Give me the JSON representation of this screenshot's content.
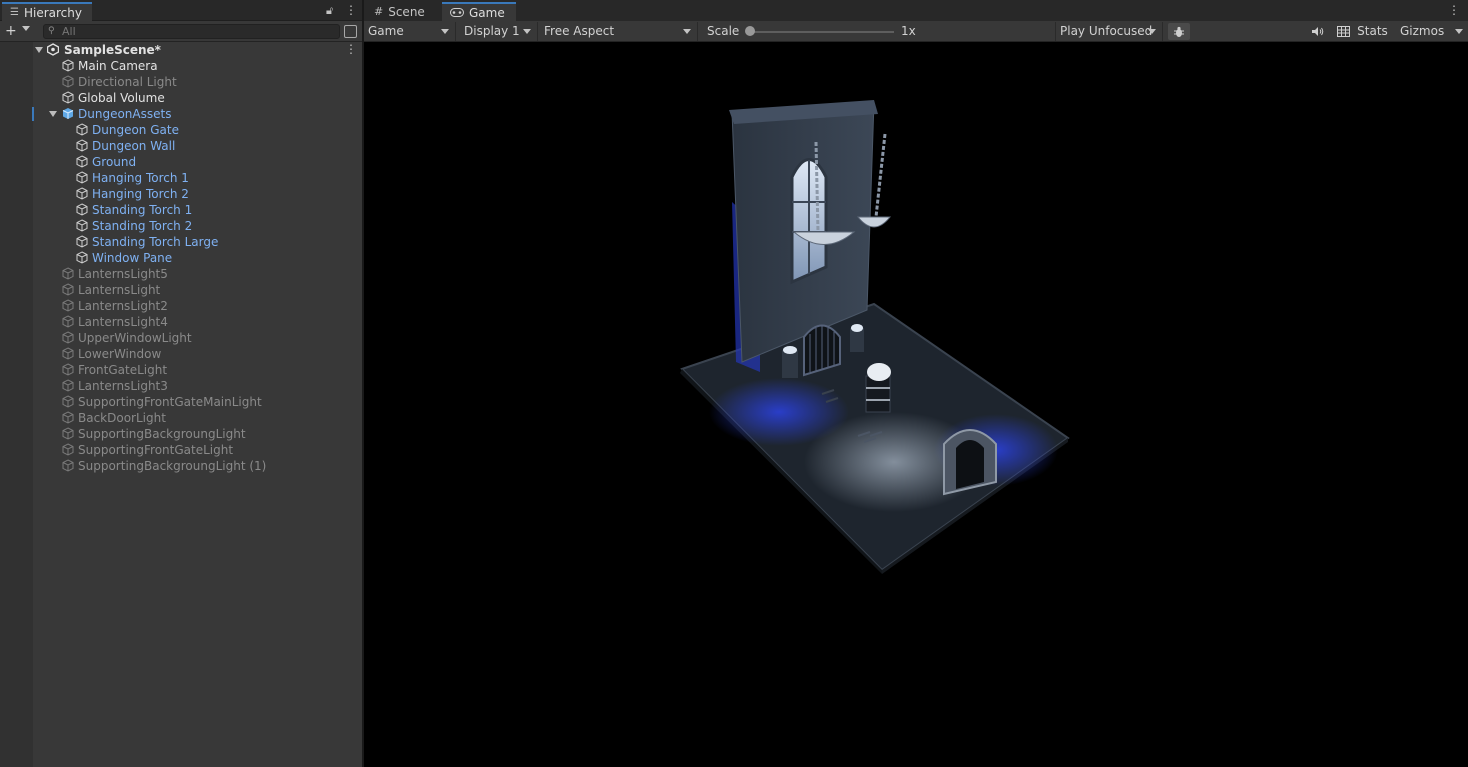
{
  "hierarchy": {
    "tab_label": "Hierarchy",
    "search_placeholder": "All",
    "scene_name": "SampleScene*",
    "items": [
      {
        "label": "Main Camera",
        "state": "active"
      },
      {
        "label": "Directional Light",
        "state": "disabled"
      },
      {
        "label": "Global Volume",
        "state": "active"
      },
      {
        "label": "DungeonAssets",
        "state": "prefab",
        "expanded": true
      }
    ],
    "children": [
      {
        "label": "Dungeon Gate"
      },
      {
        "label": "Dungeon Wall"
      },
      {
        "label": "Ground"
      },
      {
        "label": "Hanging Torch 1"
      },
      {
        "label": "Hanging Torch 2"
      },
      {
        "label": "Standing Torch 1"
      },
      {
        "label": "Standing Torch 2"
      },
      {
        "label": "Standing Torch Large"
      },
      {
        "label": "Window Pane"
      }
    ],
    "disabled_items": [
      {
        "label": "LanternsLight5"
      },
      {
        "label": "LanternsLight"
      },
      {
        "label": "LanternsLight2"
      },
      {
        "label": "LanternsLight4"
      },
      {
        "label": "UpperWindowLight"
      },
      {
        "label": "LowerWindow"
      },
      {
        "label": "FrontGateLight"
      },
      {
        "label": "LanternsLight3"
      },
      {
        "label": "SupportingFrontGateMainLight"
      },
      {
        "label": "BackDoorLight"
      },
      {
        "label": "SupportingBackgroungLight"
      },
      {
        "label": "SupportingFrontGateLight"
      },
      {
        "label": "SupportingBackgroungLight (1)"
      }
    ]
  },
  "game_view": {
    "tabs": [
      {
        "label": "Scene"
      },
      {
        "label": "Game"
      }
    ],
    "view_mode": "Game",
    "display": "Display 1",
    "aspect": "Free Aspect",
    "scale_label": "Scale",
    "scale_value": "1x",
    "play_mode": "Play Unfocused",
    "stats_label": "Stats",
    "gizmos_label": "Gizmos"
  },
  "colors": {
    "accent": "#3a79bb",
    "prefab_text": "#7fb1f2",
    "disabled_text": "#8a8a8a"
  }
}
